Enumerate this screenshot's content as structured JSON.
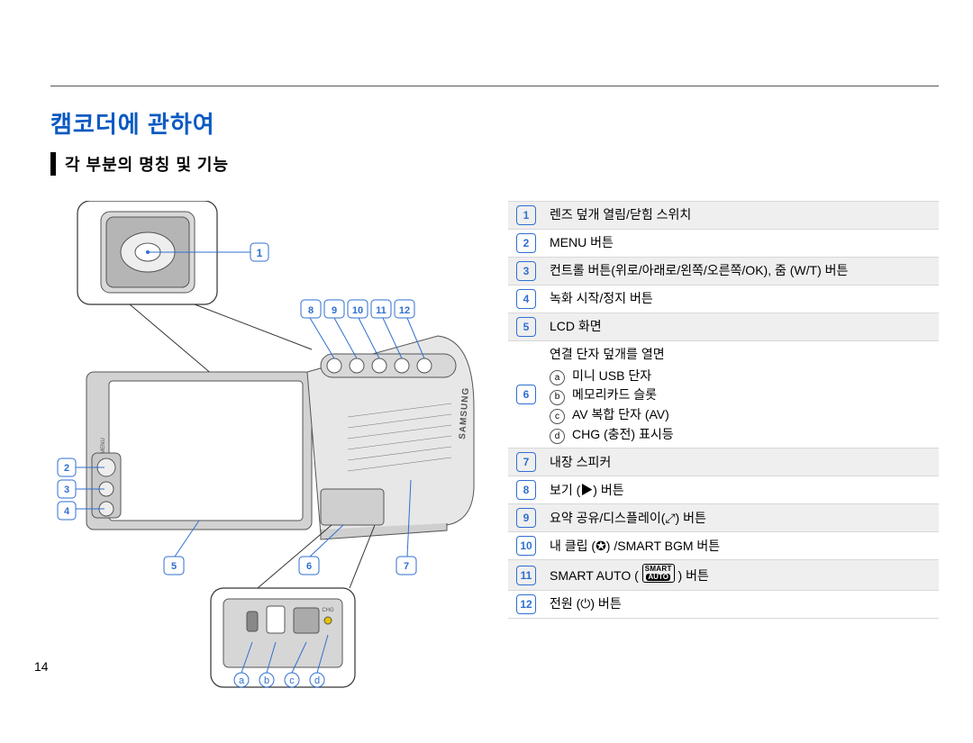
{
  "page_number": "14",
  "title": "캠코더에 관하여",
  "subtitle": "각 부분의 명칭 및 기능",
  "callout_labels": {
    "top_row": [
      "8",
      "9",
      "10",
      "11",
      "12"
    ],
    "left_col": [
      "2",
      "3",
      "4"
    ],
    "lower_row": [
      "5",
      "6",
      "7"
    ],
    "detail_lens": "1",
    "detail_ports": [
      "a",
      "b",
      "c",
      "d"
    ]
  },
  "parts": [
    {
      "num": "1",
      "label": "렌즈 덮개 열림/닫힘 스위치"
    },
    {
      "num": "2",
      "label": "MENU 버튼"
    },
    {
      "num": "3",
      "label": "컨트롤 버튼(위로/아래로/왼쪽/오른쪽/OK), 줌 (W/T) 버튼"
    },
    {
      "num": "4",
      "label": "녹화 시작/정지 버튼"
    },
    {
      "num": "5",
      "label": "LCD 화면"
    },
    {
      "num": "6",
      "label": "연결 단자 덮개를 열면\n",
      "subs": [
        {
          "mark": "a",
          "label": "미니 USB 단자"
        },
        {
          "mark": "b",
          "label": "메모리카드 슬롯"
        },
        {
          "mark": "c",
          "label": "AV 복합 단자 (AV)"
        },
        {
          "mark": "d",
          "label": "CHG (충전) 표시등"
        }
      ]
    },
    {
      "num": "7",
      "label": "내장 스피커"
    },
    {
      "num": "8",
      "label": "보기 (▶) 버튼"
    },
    {
      "num": "9",
      "label": "요약 공유/디스플레이(⤢) 버튼"
    },
    {
      "num": "10",
      "label": "내 클립 (✪) /SMART BGM 버튼"
    },
    {
      "num": "11",
      "label": "SMART AUTO ( ",
      "trailing_icon": "smart-auto",
      "label_after": " ) 버튼"
    },
    {
      "num": "12",
      "label": "전원 (⏻) 버튼"
    }
  ]
}
